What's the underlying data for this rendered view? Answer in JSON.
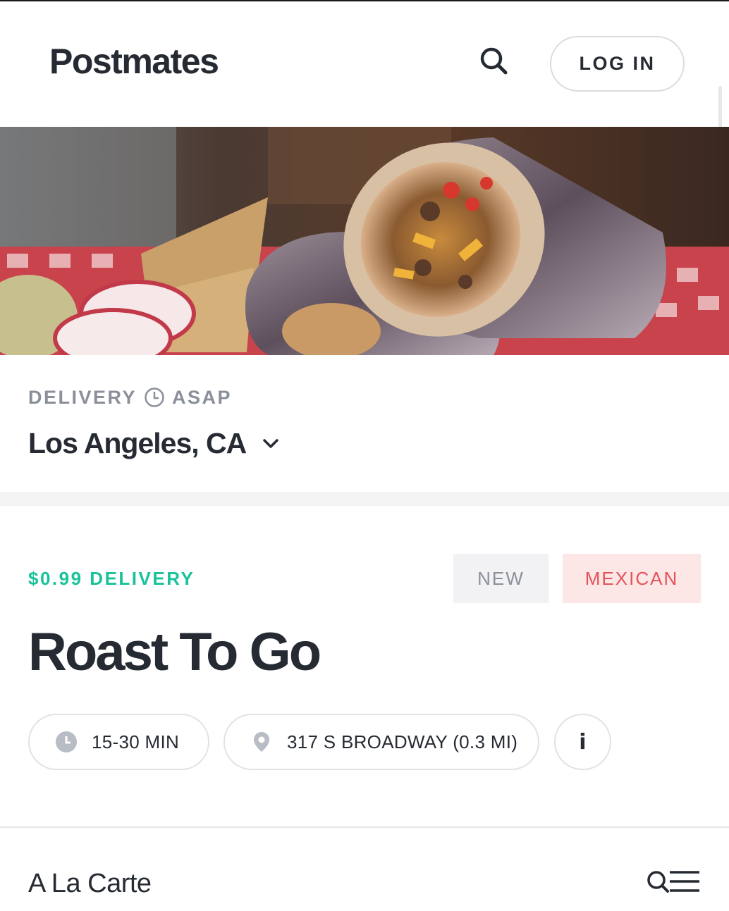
{
  "header": {
    "logo": "Postmates",
    "search_icon": "search-icon",
    "login_label": "LOG IN"
  },
  "hero": {
    "image": "burrito-photo"
  },
  "delivery": {
    "mode_label": "DELIVERY",
    "time_label": "ASAP",
    "location": "Los Angeles, CA",
    "clock_icon": "clock-icon",
    "chevron_icon": "chevron-down-icon"
  },
  "store": {
    "delivery_fee": "$0.99 DELIVERY",
    "badges": [
      "NEW",
      "MEXICAN"
    ],
    "name": "Roast To Go",
    "eta": "15-30 MIN",
    "address": "317 S BROADWAY (0.3 MI)",
    "info_label": "i"
  },
  "menu": {
    "title": "A La Carte",
    "menu_search_icon": "menu-search-icon"
  },
  "colors": {
    "accent_green": "#19c39a",
    "badge_red_text": "#e2545a",
    "badge_red_bg": "#fde6e6",
    "text_dark": "#262b33",
    "text_gray": "#8a8f99"
  }
}
